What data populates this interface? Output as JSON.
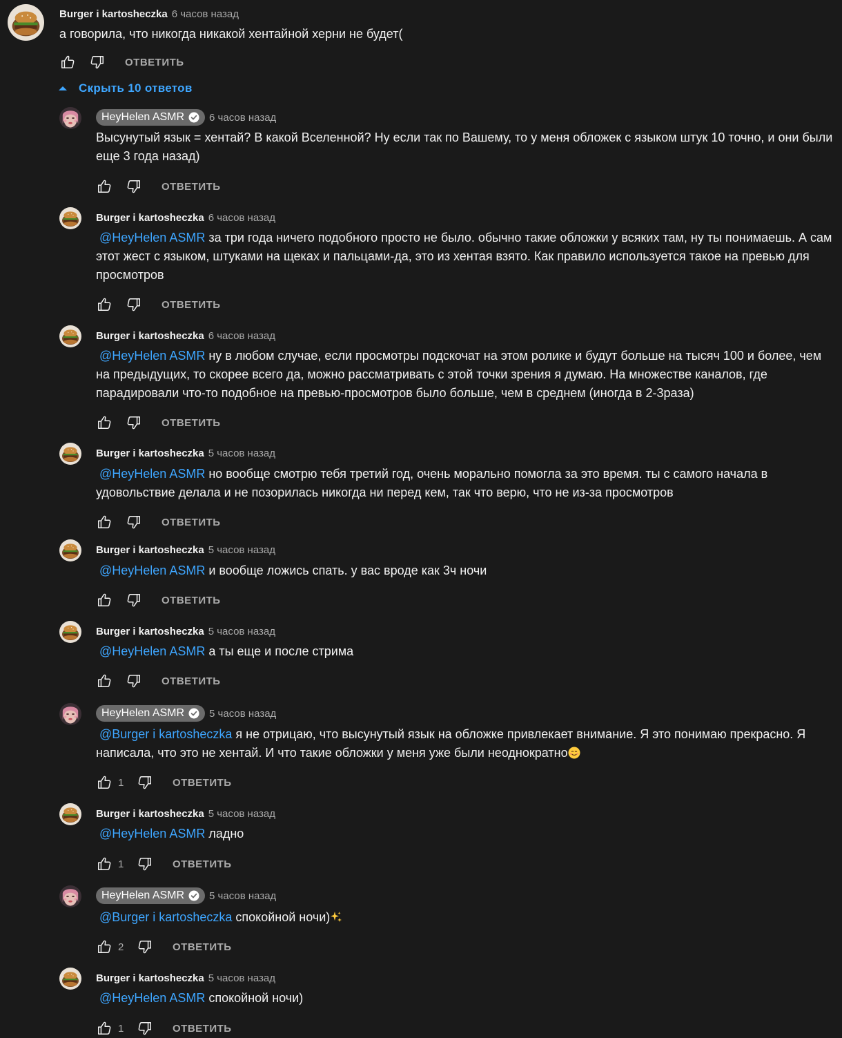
{
  "top_comment": {
    "author": "Burger i kartosheczka",
    "time": "6 часов назад",
    "text": "а говорила, что никогда никакой хентайной херни не будет(",
    "reply_label": "ОТВЕТИТЬ"
  },
  "replies_toggle": {
    "label": "Скрыть 10 ответов"
  },
  "replies": [
    {
      "author": "HeyHelen ASMR",
      "time": "6 часов назад",
      "mention": "",
      "text": "Высунутый язык = хентай? В какой Вселенной? Ну если так по Вашему, то у меня обложек с языком штук 10 точно, и они были еще 3 года назад)",
      "likes": "",
      "reply_label": "ОТВЕТИТЬ"
    },
    {
      "author": "Burger i kartosheczka",
      "time": "6 часов назад",
      "mention": "@HeyHelen ASMR",
      "text": "за три года ничего подобного просто не было. обычно такие обложки у всяких там, ну ты понимаешь. А сам этот жест с языком, штуками на щеках и пальцами-да, это из хентая взято. Как правило используется такое на превью для просмотров",
      "likes": "",
      "reply_label": "ОТВЕТИТЬ"
    },
    {
      "author": "Burger i kartosheczka",
      "time": "6 часов назад",
      "mention": "@HeyHelen ASMR",
      "text": "ну в любом случае, если просмотры подскочат на этом ролике и будут больше на тысяч 100 и более, чем на предыдущих, то скорее всего да, можно рассматривать с этой точки зрения я думаю. На множестве каналов, где парадировали что-то подобное на превью-просмотров было больше, чем в среднем (иногда в 2-3раза)",
      "likes": "",
      "reply_label": "ОТВЕТИТЬ"
    },
    {
      "author": "Burger i kartosheczka",
      "time": "5 часов назад",
      "mention": "@HeyHelen ASMR",
      "text": "но вообще смотрю тебя третий год, очень морально помогла за это время. ты с самого начала в удовольствие делала и не позорилась никогда ни перед кем, так что верю, что не из-за просмотров",
      "likes": "",
      "reply_label": "ОТВЕТИТЬ"
    },
    {
      "author": "Burger i kartosheczka",
      "time": "5 часов назад",
      "mention": "@HeyHelen ASMR",
      "text": "и вообще ложись спать. у вас вроде как 3ч ночи",
      "likes": "",
      "reply_label": "ОТВЕТИТЬ"
    },
    {
      "author": "Burger i kartosheczka",
      "time": "5 часов назад",
      "mention": "@HeyHelen ASMR",
      "text": "а ты еще и после стрима",
      "likes": "",
      "reply_label": "ОТВЕТИТЬ"
    },
    {
      "author": "HeyHelen ASMR",
      "time": "5 часов назад",
      "mention": "@Burger i kartosheczka",
      "text": "я не отрицаю, что высунутый язык на обложке привлекает внимание. Я это понимаю прекрасно. Я написала, что это не хентай. И что такие обложки у меня уже были неоднократно",
      "emoji": "smiling-face-emoji",
      "likes": "1",
      "reply_label": "ОТВЕТИТЬ"
    },
    {
      "author": "Burger i kartosheczka",
      "time": "5 часов назад",
      "mention": "@HeyHelen ASMR",
      "text": "ладно",
      "likes": "1",
      "reply_label": "ОТВЕТИТЬ"
    },
    {
      "author": "HeyHelen ASMR",
      "time": "5 часов назад",
      "mention": "@Burger i kartosheczka",
      "text": "спокойной ночи)",
      "emoji": "sparkles-emoji",
      "likes": "2",
      "reply_label": "ОТВЕТИТЬ"
    },
    {
      "author": "Burger i kartosheczka",
      "time": "5 часов назад",
      "mention": "@HeyHelen ASMR",
      "text": "спокойной ночи)",
      "likes": "1",
      "reply_label": "ОТВЕТИТЬ"
    }
  ],
  "colors": {
    "background": "#1a1a1a",
    "text": "#f1f1f1",
    "secondary": "#aaaaaa",
    "link": "#3ea6ff",
    "author_chip": "#6b6b6b"
  }
}
